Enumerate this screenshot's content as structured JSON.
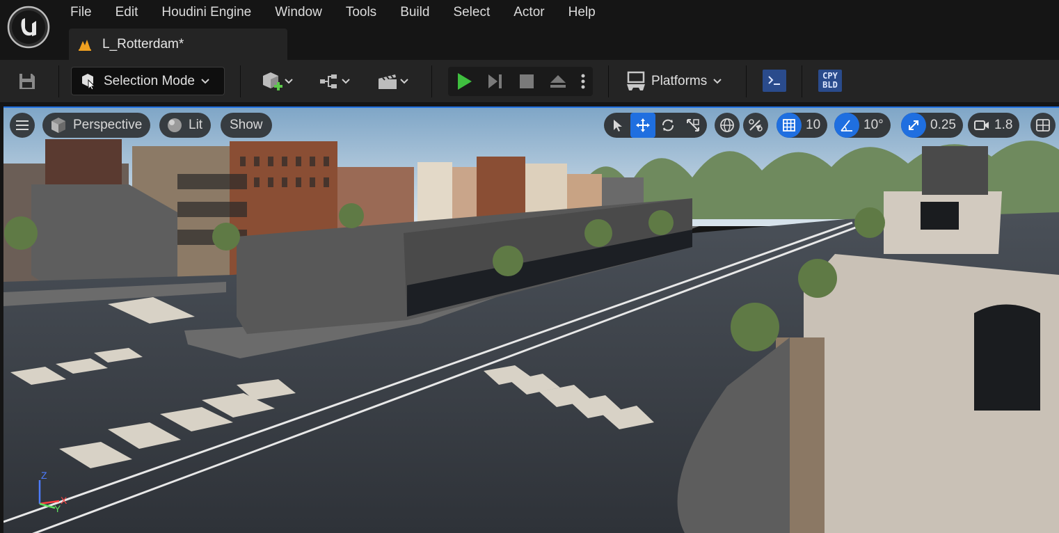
{
  "app": {
    "logo": "unreal-engine-logo"
  },
  "menu": {
    "items": [
      "File",
      "Edit",
      "Houdini Engine",
      "Window",
      "Tools",
      "Build",
      "Select",
      "Actor",
      "Help"
    ]
  },
  "document_tab": {
    "label": "L_Rotterdam*",
    "icon": "level-icon"
  },
  "toolbar": {
    "save_icon": "save-icon",
    "selection_mode": "Selection Mode",
    "platforms": "Platforms",
    "cpy": "CPY",
    "bld": "BLD"
  },
  "viewport": {
    "perspective": "Perspective",
    "lit": "Lit",
    "show": "Show",
    "grid_snap": "10",
    "rotation_snap": "10°",
    "scale_snap": "0.25",
    "camera_speed": "1.8",
    "axis": {
      "x": "X",
      "y": "Y",
      "z": "Z"
    }
  },
  "colors": {
    "accent": "#1f6fe0",
    "play": "#3fbf3f",
    "panel": "#242424",
    "background": "#151515"
  }
}
